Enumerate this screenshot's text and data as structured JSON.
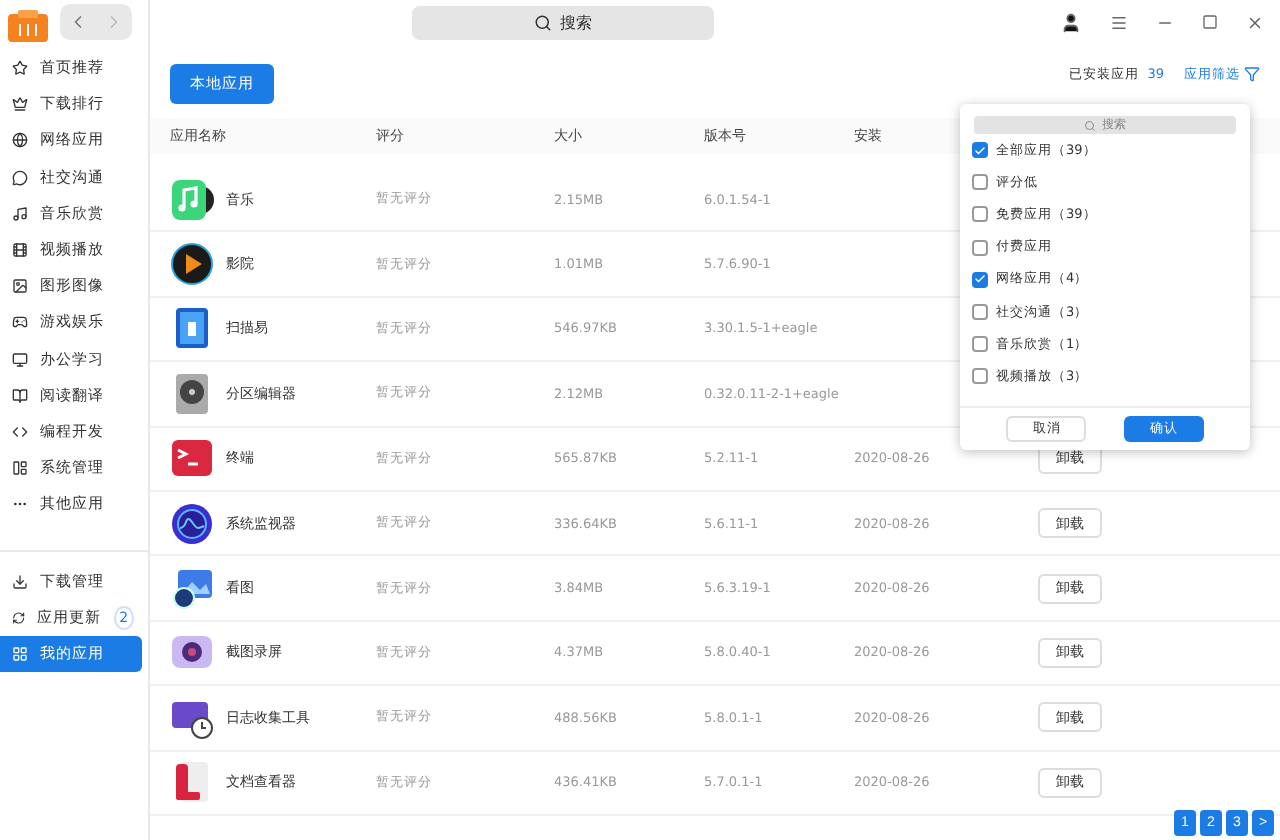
{
  "toolbar": {
    "search_placeholder": "搜索"
  },
  "sidebar": {
    "items": [
      {
        "label": "首页推荐",
        "selected": false
      },
      {
        "label": "下载排行",
        "selected": false
      },
      {
        "label": "网络应用",
        "selected": false
      },
      {
        "label": "社交沟通",
        "selected": false
      },
      {
        "label": "音乐欣赏",
        "selected": false
      },
      {
        "label": "视频播放",
        "selected": false
      },
      {
        "label": "图形图像",
        "selected": false
      },
      {
        "label": "游戏娱乐",
        "selected": false
      },
      {
        "label": "办公学习",
        "selected": false
      },
      {
        "label": "阅读翻译",
        "selected": false
      },
      {
        "label": "编程开发",
        "selected": false
      },
      {
        "label": "系统管理",
        "selected": false
      },
      {
        "label": "其他应用",
        "selected": false
      }
    ],
    "bottom_items": [
      {
        "label": "下载管理",
        "selected": false
      },
      {
        "label": "应用更新",
        "badge": "2",
        "selected": false
      },
      {
        "label": "我的应用",
        "selected": true
      }
    ]
  },
  "local_apps_button": "本地应用",
  "installed_label": "已安装应用",
  "installed_count": "39",
  "filter_link": "应用筛选",
  "table": {
    "columns": [
      "应用名称",
      "评分",
      "大小",
      "版本号",
      "安装"
    ],
    "rows": [
      {
        "name": "音乐",
        "rating": "暂无评分",
        "size": "2.15MB",
        "version": "6.0.1.54-1"
      },
      {
        "name": "影院",
        "rating": "暂无评分",
        "size": "1.01MB",
        "version": "5.7.6.90-1"
      },
      {
        "name": "扫描易",
        "rating": "暂无评分",
        "size": "546.97KB",
        "version": "3.30.1.5-1+eagle"
      },
      {
        "name": "分区编辑器",
        "rating": "暂无评分",
        "size": "2.12MB",
        "version": "0.32.0.11-2-1+eagle"
      },
      {
        "name": "终端",
        "rating": "暂无评分",
        "size": "565.87KB",
        "version": "5.2.11-1",
        "date": "2020-08-26",
        "action": "卸载"
      },
      {
        "name": "系统监视器",
        "rating": "暂无评分",
        "size": "336.64KB",
        "version": "5.6.11-1",
        "date": "2020-08-26",
        "action": "卸载"
      },
      {
        "name": "看图",
        "rating": "暂无评分",
        "size": "3.84MB",
        "version": "5.6.3.19-1",
        "date": "2020-08-26",
        "action": "卸载"
      },
      {
        "name": "截图录屏",
        "rating": "暂无评分",
        "size": "4.37MB",
        "version": "5.8.0.40-1",
        "date": "2020-08-26",
        "action": "卸载"
      },
      {
        "name": "日志收集工具",
        "rating": "暂无评分",
        "size": "488.56KB",
        "version": "5.8.0.1-1",
        "date": "2020-08-26",
        "action": "卸载"
      },
      {
        "name": "文档查看器",
        "rating": "暂无评分",
        "size": "436.41KB",
        "version": "5.7.0.1-1",
        "date": "2020-08-26",
        "action": "卸载"
      }
    ]
  },
  "pagination": [
    "1",
    "2",
    "3",
    ">"
  ],
  "filter_popup": {
    "search_placeholder": "搜索",
    "options": [
      {
        "label": "全部应用（39）",
        "checked": true
      },
      {
        "label": "评分低",
        "checked": false
      },
      {
        "label": "免费应用（39）",
        "checked": false
      },
      {
        "label": "付费应用",
        "checked": false
      },
      {
        "label": "网络应用（4）",
        "checked": true
      },
      {
        "label": "社交沟通（3）",
        "checked": false
      },
      {
        "label": "音乐欣赏（1）",
        "checked": false
      },
      {
        "label": "视频播放（3）",
        "checked": false
      }
    ],
    "cancel": "取消",
    "confirm": "确认"
  }
}
